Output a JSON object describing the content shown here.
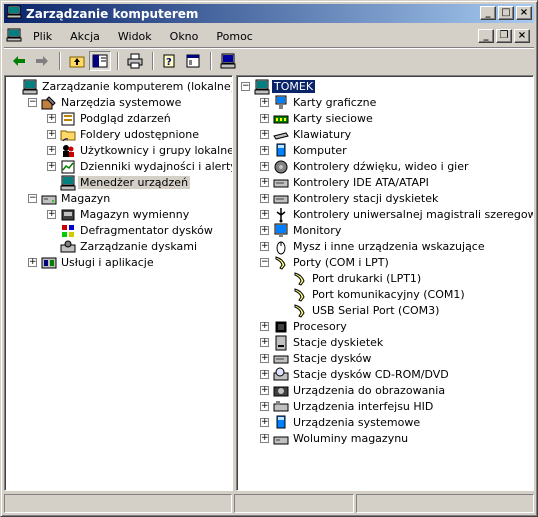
{
  "window": {
    "title": "Zarządzanie komputerem"
  },
  "menu": {
    "items": [
      {
        "label": "Plik",
        "name": "menu-plik"
      },
      {
        "label": "Akcja",
        "name": "menu-akcja"
      },
      {
        "label": "Widok",
        "name": "menu-widok"
      },
      {
        "label": "Okno",
        "name": "menu-okno"
      },
      {
        "label": "Pomoc",
        "name": "menu-pomoc"
      }
    ]
  },
  "toolbar": {
    "buttons": [
      "back-icon",
      "forward-icon",
      "up-folder-icon",
      "show-hide-tree-icon",
      "print-icon",
      "help-icon",
      "properties-icon",
      "device-manager-icon"
    ]
  },
  "left_tree": [
    {
      "label": "Zarządzanie komputerem (lokalne)",
      "level": 0,
      "expander": "none",
      "icon": "computer-icon"
    },
    {
      "label": "Narzędzia systemowe",
      "level": 1,
      "expander": "minus",
      "icon": "tools-icon"
    },
    {
      "label": "Podgląd zdarzeń",
      "level": 2,
      "expander": "plus",
      "icon": "event-viewer-icon"
    },
    {
      "label": "Foldery udostępnione",
      "level": 2,
      "expander": "plus",
      "icon": "shared-folder-icon"
    },
    {
      "label": "Użytkownicy i grupy lokalne",
      "level": 2,
      "expander": "plus",
      "icon": "users-icon"
    },
    {
      "label": "Dzienniki wydajności i alerty",
      "level": 2,
      "expander": "plus",
      "icon": "performance-icon"
    },
    {
      "label": "Menedżer urządzeń",
      "level": 2,
      "expander": "none",
      "icon": "device-manager-icon",
      "selected": true
    },
    {
      "label": "Magazyn",
      "level": 1,
      "expander": "minus",
      "icon": "storage-icon"
    },
    {
      "label": "Magazyn wymienny",
      "level": 2,
      "expander": "plus",
      "icon": "removable-storage-icon"
    },
    {
      "label": "Defragmentator dysków",
      "level": 2,
      "expander": "none",
      "icon": "defrag-icon"
    },
    {
      "label": "Zarządzanie dyskami",
      "level": 2,
      "expander": "none",
      "icon": "disk-management-icon"
    },
    {
      "label": "Usługi i aplikacje",
      "level": 1,
      "expander": "plus",
      "icon": "services-icon"
    }
  ],
  "right_tree": [
    {
      "label": "TOMEK",
      "level": 0,
      "expander": "minus",
      "icon": "computer-icon",
      "focused": true
    },
    {
      "label": "Karty graficzne",
      "level": 1,
      "expander": "plus",
      "icon": "display-adapter-icon"
    },
    {
      "label": "Karty sieciowe",
      "level": 1,
      "expander": "plus",
      "icon": "network-adapter-icon"
    },
    {
      "label": "Klawiatury",
      "level": 1,
      "expander": "plus",
      "icon": "keyboard-icon"
    },
    {
      "label": "Komputer",
      "level": 1,
      "expander": "plus",
      "icon": "computer-small-icon"
    },
    {
      "label": "Kontrolery dźwięku, wideo i gier",
      "level": 1,
      "expander": "plus",
      "icon": "sound-icon"
    },
    {
      "label": "Kontrolery IDE ATA/ATAPI",
      "level": 1,
      "expander": "plus",
      "icon": "ide-controller-icon"
    },
    {
      "label": "Kontrolery stacji dyskietek",
      "level": 1,
      "expander": "plus",
      "icon": "floppy-controller-icon"
    },
    {
      "label": "Kontrolery uniwersalnej magistrali szeregowej",
      "level": 1,
      "expander": "plus",
      "icon": "usb-icon"
    },
    {
      "label": "Monitory",
      "level": 1,
      "expander": "plus",
      "icon": "monitor-icon"
    },
    {
      "label": "Mysz i inne urządzenia wskazujące",
      "level": 1,
      "expander": "plus",
      "icon": "mouse-icon"
    },
    {
      "label": "Porty (COM i LPT)",
      "level": 1,
      "expander": "minus",
      "icon": "port-icon"
    },
    {
      "label": "Port drukarki (LPT1)",
      "level": 2,
      "expander": "none",
      "icon": "port-icon"
    },
    {
      "label": "Port komunikacyjny (COM1)",
      "level": 2,
      "expander": "none",
      "icon": "port-icon"
    },
    {
      "label": "USB Serial Port (COM3)",
      "level": 2,
      "expander": "none",
      "icon": "port-icon"
    },
    {
      "label": "Procesory",
      "level": 1,
      "expander": "plus",
      "icon": "processor-icon"
    },
    {
      "label": "Stacje dyskietek",
      "level": 1,
      "expander": "plus",
      "icon": "floppy-drive-icon"
    },
    {
      "label": "Stacje dysków",
      "level": 1,
      "expander": "plus",
      "icon": "disk-drive-icon"
    },
    {
      "label": "Stacje dysków CD-ROM/DVD",
      "level": 1,
      "expander": "plus",
      "icon": "cdrom-icon"
    },
    {
      "label": "Urządzenia do obrazowania",
      "level": 1,
      "expander": "plus",
      "icon": "imaging-icon"
    },
    {
      "label": "Urządzenia interfejsu HID",
      "level": 1,
      "expander": "plus",
      "icon": "hid-icon"
    },
    {
      "label": "Urządzenia systemowe",
      "level": 1,
      "expander": "plus",
      "icon": "system-device-icon"
    },
    {
      "label": "Woluminy magazynu",
      "level": 1,
      "expander": "plus",
      "icon": "storage-volume-icon"
    }
  ]
}
